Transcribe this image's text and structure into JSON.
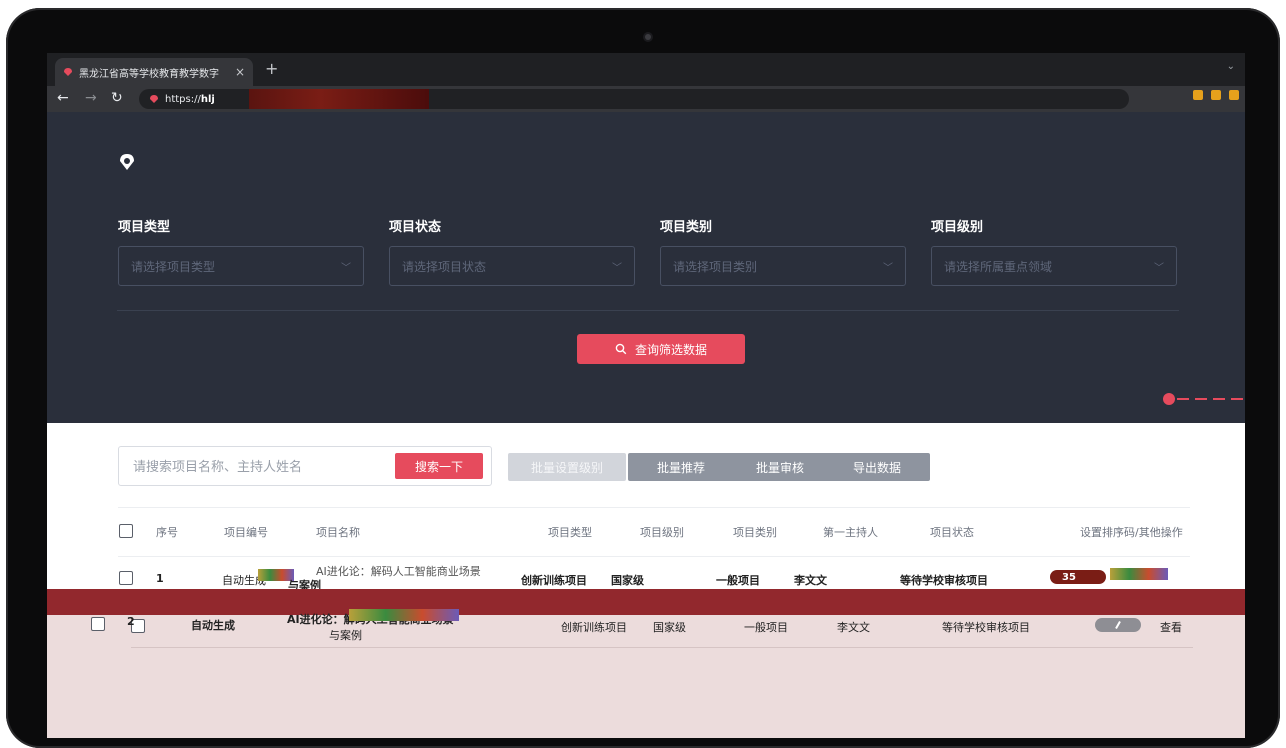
{
  "browser": {
    "tab_title": "黑龙江省高等学校教育教学数字",
    "tab_close": "×",
    "new_tab": "+",
    "tab_menu": "⌄",
    "url_prefix": "https://",
    "url_host": "hlj"
  },
  "filters": [
    {
      "label": "项目类型",
      "placeholder": "请选择项目类型"
    },
    {
      "label": "项目状态",
      "placeholder": "请选择项目状态"
    },
    {
      "label": "项目类别",
      "placeholder": "请选择项目类别"
    },
    {
      "label": "项目级别",
      "placeholder": "请选择所属重点领域"
    }
  ],
  "query_button": "查询筛选数据",
  "search": {
    "placeholder": "请搜索项目名称、主持人姓名",
    "button": "搜索一下"
  },
  "toolbar": {
    "batch_level": "批量设置级别",
    "batch_recommend": "批量推荐",
    "batch_review": "批量审核",
    "export": "导出数据"
  },
  "table": {
    "columns": [
      "序号",
      "项目编号",
      "项目名称",
      "项目类型",
      "项目级别",
      "项目类别",
      "第一主持人",
      "项目状态",
      "设置排序码/其他操作"
    ],
    "rows": [
      {
        "index": "1",
        "code": "自动生成",
        "name_line1": "AI进化论：解码人工智能商业场景",
        "name_line2": "与案例",
        "type": "创新训练项目",
        "level": "国家级",
        "category": "一般项目",
        "host": "李文文",
        "status": "等待学校审核项目",
        "sort_code": "35"
      },
      {
        "index": "2",
        "code": "自动生成",
        "name_line1": "AI进化论：解码人工智能商业场景",
        "name_line2": "与案例",
        "type": "创新训练项目",
        "level": "国家级",
        "category": "一般项目",
        "host": "李文文",
        "status": "等待学校审核项目",
        "action": "查看"
      }
    ]
  },
  "colors": {
    "accent": "#e64b5d",
    "panel_bg": "#2a2f3b",
    "band_red": "#92282d",
    "band_pink": "#ecdcdc"
  }
}
